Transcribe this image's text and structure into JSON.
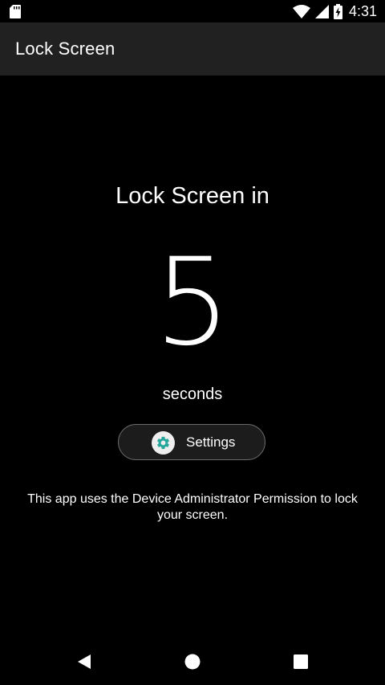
{
  "status_bar": {
    "time": "4:31",
    "icons": [
      "sd-card-icon",
      "wifi-icon",
      "signal-icon",
      "battery-charging-icon"
    ]
  },
  "app_bar": {
    "title": "Lock Screen"
  },
  "main": {
    "heading": "Lock Screen in",
    "countdown": "5",
    "unit": "seconds",
    "settings_button": {
      "label": "Settings",
      "icon": "gear-icon",
      "icon_color": "#26A69A"
    },
    "info": "This app uses the Device Administrator Permission to lock your screen."
  },
  "nav_bar": {
    "icons": [
      "back-icon",
      "home-icon",
      "recents-icon"
    ]
  },
  "colors": {
    "background": "#000000",
    "app_bar": "#212121",
    "text": "#FFFFFF",
    "accent": "#26A69A"
  }
}
